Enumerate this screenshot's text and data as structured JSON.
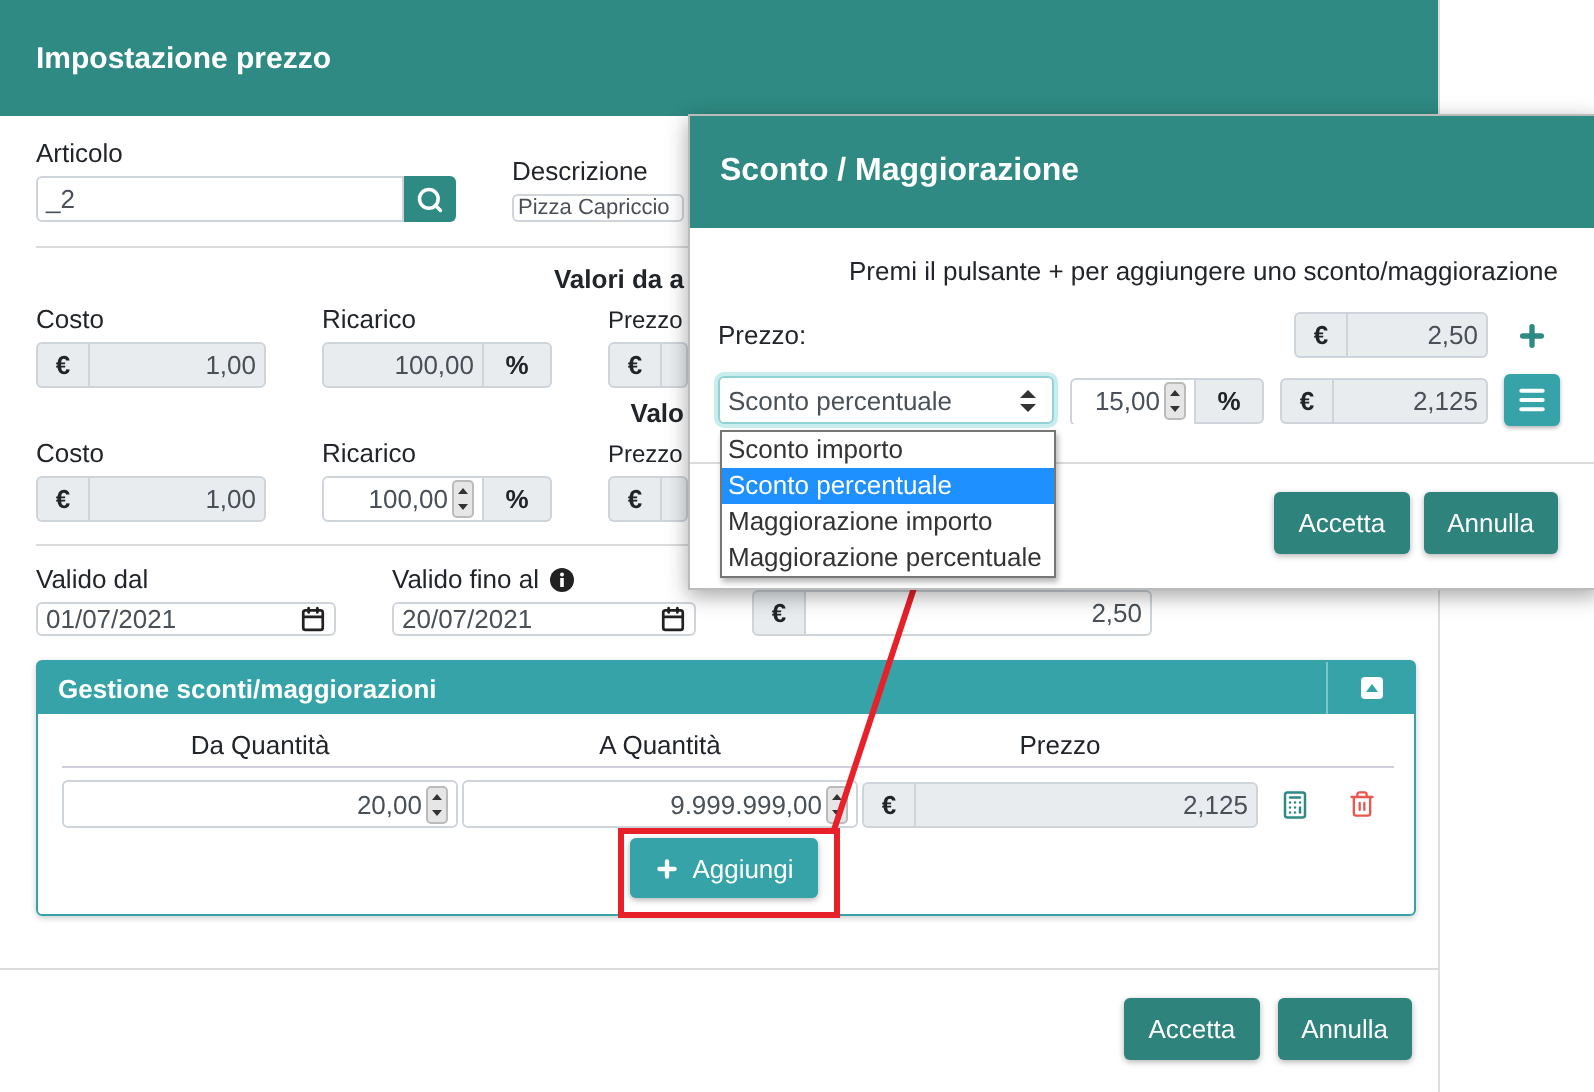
{
  "main_dialog": {
    "title": "Impostazione prezzo",
    "articolo": {
      "label": "Articolo",
      "value": "_2"
    },
    "descrizione": {
      "label": "Descrizione",
      "value": "Pizza Capriccio"
    },
    "groups": [
      {
        "heading": "Valori da a",
        "fields": [
          {
            "label": "Costo",
            "prefix": "€",
            "value": "1,00",
            "disabled": true
          },
          {
            "label": "Ricarico",
            "value": "100,00",
            "suffix": "%",
            "disabled": true
          },
          {
            "label": "Prezzo",
            "prefix": "€",
            "disabled": true
          }
        ]
      },
      {
        "heading": "Valo",
        "fields": [
          {
            "label": "Costo",
            "prefix": "€",
            "value": "1,00",
            "disabled": true
          },
          {
            "label": "Ricarico",
            "value": "100,00",
            "suffix": "%",
            "disabled": false
          },
          {
            "label": "Prezzo",
            "prefix": "€",
            "disabled": true
          }
        ]
      }
    ],
    "validity": [
      {
        "label": "Valido dal",
        "value": "01/07/2021",
        "info": false
      },
      {
        "label": "Valido fino al",
        "value": "20/07/2021",
        "info": true
      }
    ],
    "final_price": {
      "prefix": "€",
      "value": "2,50"
    },
    "panel": {
      "title": "Gestione sconti/maggiorazioni",
      "expanded": true,
      "columns": [
        "Da Quantità",
        "A Quantità",
        "Prezzo"
      ],
      "rows": [
        {
          "from": "20,00",
          "to": "9.999.999,00",
          "prefix": "€",
          "price": "2,125"
        }
      ],
      "add_button": "Aggiungi"
    },
    "buttons": [
      "Accetta",
      "Annulla"
    ]
  },
  "overlay_dialog": {
    "title": "Sconto / Maggiorazione",
    "hint": "Premi il pulsante + per aggiungere uno sconto/maggiorazione",
    "price_label": "Prezzo:",
    "price": {
      "prefix": "€",
      "value": "2,50"
    },
    "select": {
      "value": "Sconto percentuale",
      "expanded": true,
      "options": [
        {
          "label": "Sconto importo",
          "selected": false
        },
        {
          "label": "Sconto percentuale",
          "selected": true
        },
        {
          "label": "Maggiorazione importo",
          "selected": false
        },
        {
          "label": "Maggiorazione percentuale",
          "selected": false
        }
      ]
    },
    "amount": {
      "value": "15,00",
      "suffix": "%"
    },
    "result": {
      "prefix": "€",
      "value": "2,125"
    },
    "buttons": [
      "Accetta",
      "Annulla"
    ]
  },
  "annotation": {
    "highlight": true
  }
}
